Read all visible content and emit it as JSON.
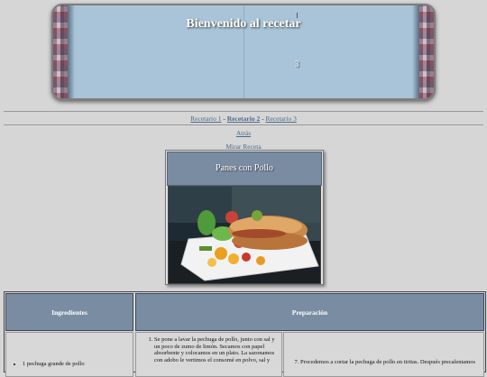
{
  "banner": {
    "title": "Bienvenido al recetar",
    "mark": "3"
  },
  "nav": {
    "items": [
      {
        "label": "Recetario 1"
      },
      {
        "label": "Recetario 2",
        "current": true
      },
      {
        "label": "Recetario 3"
      }
    ],
    "sep1": " - ",
    "sep2": " - "
  },
  "links": {
    "atras": "Atrás",
    "mirar": "Mirar Receta"
  },
  "recipe": {
    "title": "Panes con Pollo"
  },
  "table": {
    "headers": {
      "ingredientes": "Ingredientes",
      "preparacion": "Preparación"
    },
    "ingredients": [
      "1 pechuga grande de pollo"
    ],
    "steps_col1": [
      "Se pone a lavar la pechuga de pollo, junto con sal y un poco de zumo de limón. Secamos con papel absorbente y colocamos en un plato. La sazonamos con adobo le vertimos el consomé en polvo, sal y"
    ],
    "steps_col2": [
      "Procedemos a cortar la pechuga de pollo en tiritas. Después precalentamos"
    ],
    "steps_col2_start": 7
  },
  "colors": {
    "page_bg": "#d6d6d6",
    "header_blue": "#7a8ca2",
    "link": "#4a6a8a"
  }
}
